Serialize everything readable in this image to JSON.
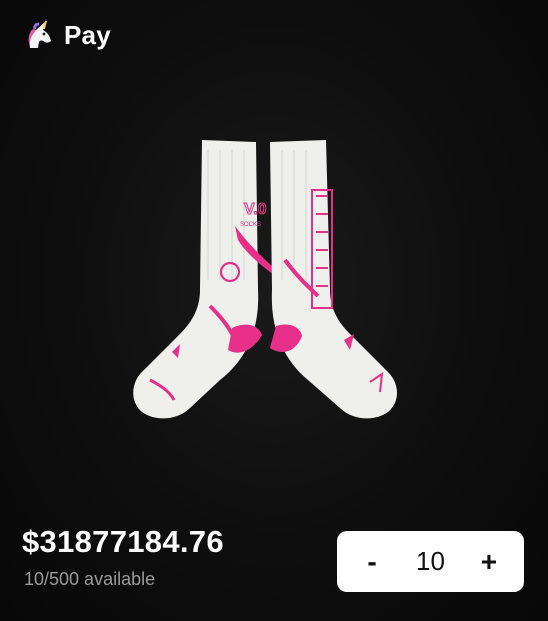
{
  "header": {
    "brand": "Pay",
    "logo_icon": "unicorn-icon"
  },
  "product": {
    "image_icon": "socks-image",
    "price": "$31877184.76",
    "availability": "10/500 available"
  },
  "quantity": {
    "decrement_label": "-",
    "value": "10",
    "increment_label": "+"
  },
  "colors": {
    "background": "#0e0e0e",
    "sock": "#efefeb",
    "accent": "#e8308a"
  }
}
